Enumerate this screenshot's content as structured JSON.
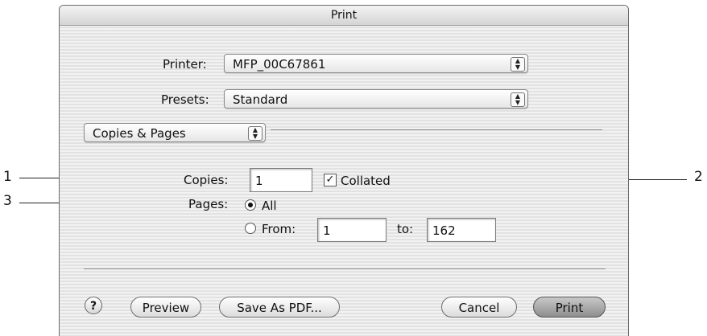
{
  "window": {
    "title": "Print"
  },
  "printer": {
    "label": "Printer:",
    "value": "MFP_00C67861"
  },
  "presets": {
    "label": "Presets:",
    "value": "Standard"
  },
  "panel": {
    "value": "Copies & Pages"
  },
  "copies": {
    "label": "Copies:",
    "value": "1"
  },
  "collated": {
    "label": "Collated",
    "checked": true
  },
  "pages": {
    "label": "Pages:",
    "all_label": "All",
    "from_label": "From:",
    "from_value": "1",
    "to_label": "to:",
    "to_value": "162",
    "selected": "all"
  },
  "buttons": {
    "help": "?",
    "preview": "Preview",
    "save_pdf": "Save As PDF...",
    "cancel": "Cancel",
    "print": "Print"
  },
  "callouts": {
    "c1": "1",
    "c2": "2",
    "c3": "3"
  },
  "icons": {
    "checkmark": "✓",
    "updown": "▲▼"
  }
}
